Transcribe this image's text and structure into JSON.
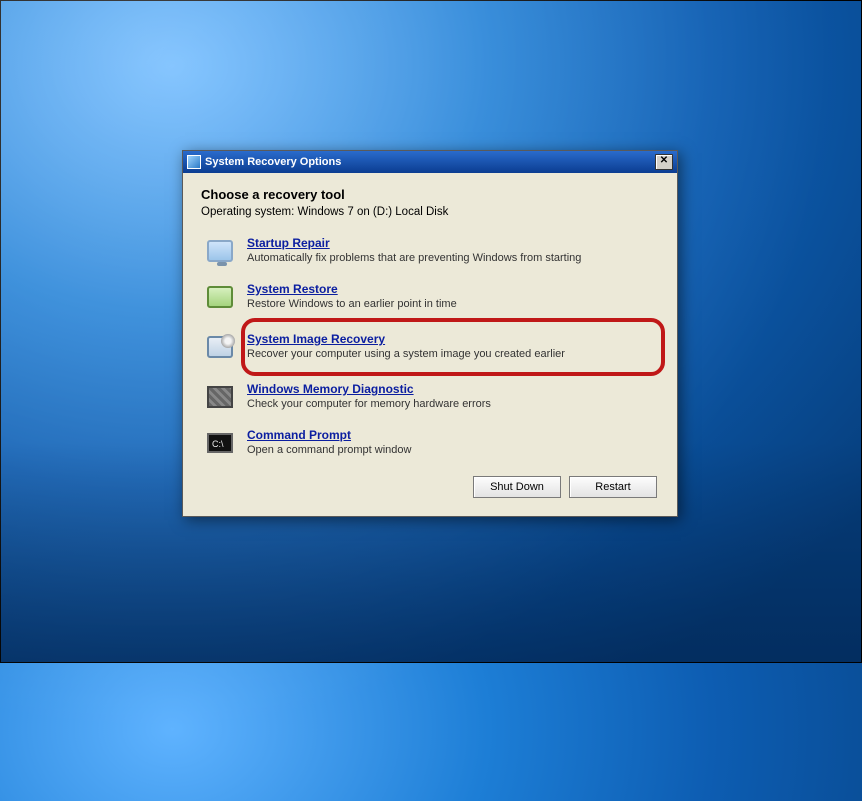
{
  "window": {
    "title": "System Recovery Options"
  },
  "heading": "Choose a recovery tool",
  "osline": "Operating system: Windows 7 on (D:) Local Disk",
  "tools": [
    {
      "title": "Startup Repair",
      "desc": "Automatically fix problems that are preventing Windows from starting"
    },
    {
      "title": "System Restore",
      "desc": "Restore Windows to an earlier point in time"
    },
    {
      "title": "System Image Recovery",
      "desc": "Recover your computer using a system image you created earlier"
    },
    {
      "title": "Windows Memory Diagnostic",
      "desc": "Check your computer for memory hardware errors"
    },
    {
      "title": "Command Prompt",
      "desc": "Open a command prompt window"
    }
  ],
  "buttons": {
    "shutdown": "Shut Down",
    "restart": "Restart"
  },
  "highlighted_index": 2
}
